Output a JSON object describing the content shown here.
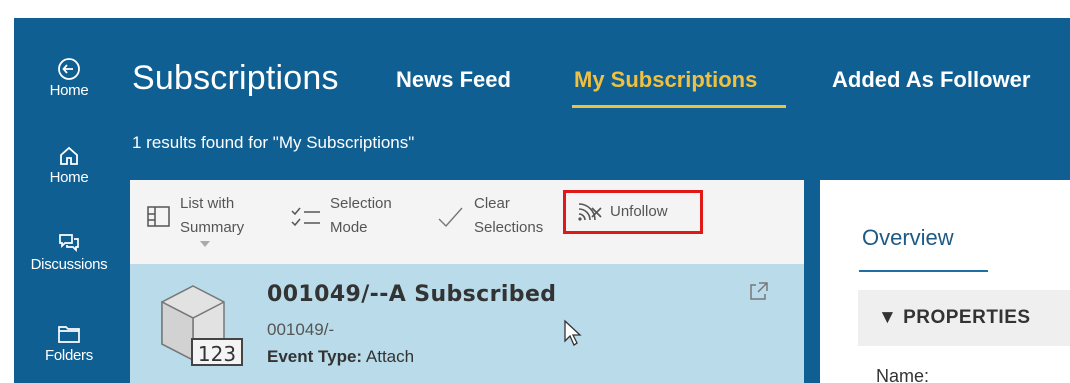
{
  "rail": {
    "items": [
      {
        "label": "Home",
        "icon": "back-circle-icon"
      },
      {
        "label": "Home",
        "icon": "home-icon"
      },
      {
        "label": "Discussions",
        "icon": "discussions-icon"
      },
      {
        "label": "Folders",
        "icon": "folder-icon"
      }
    ]
  },
  "header": {
    "title": "Subscriptions",
    "tabs": [
      {
        "label": "News Feed",
        "active": false
      },
      {
        "label": "My Subscriptions",
        "active": true
      },
      {
        "label": "Added As Follower",
        "active": false
      }
    ],
    "results_text": "1 results found for \"My Subscriptions\""
  },
  "toolbar": {
    "list_with_summary": {
      "line1": "List with",
      "line2": "Summary"
    },
    "selection_mode": {
      "line1": "Selection",
      "line2": "Mode"
    },
    "clear_selections": {
      "line1": "Clear",
      "line2": "Selections"
    },
    "unfollow": "Unfollow"
  },
  "list": {
    "items": [
      {
        "title": "001049/--A Subscribed",
        "subtitle": "001049/-",
        "event_type_label": "Event Type:",
        "event_type_value": "Attach",
        "badge": "123"
      }
    ]
  },
  "right_pane": {
    "overview_tab": "Overview",
    "properties_header": "▼ PROPERTIES",
    "name_label": "Name:"
  },
  "colors": {
    "app_bg": "#0f5f93",
    "active_tab": "#f0c040",
    "row_selected": "#b9dbea",
    "highlight_box": "#e01818"
  }
}
